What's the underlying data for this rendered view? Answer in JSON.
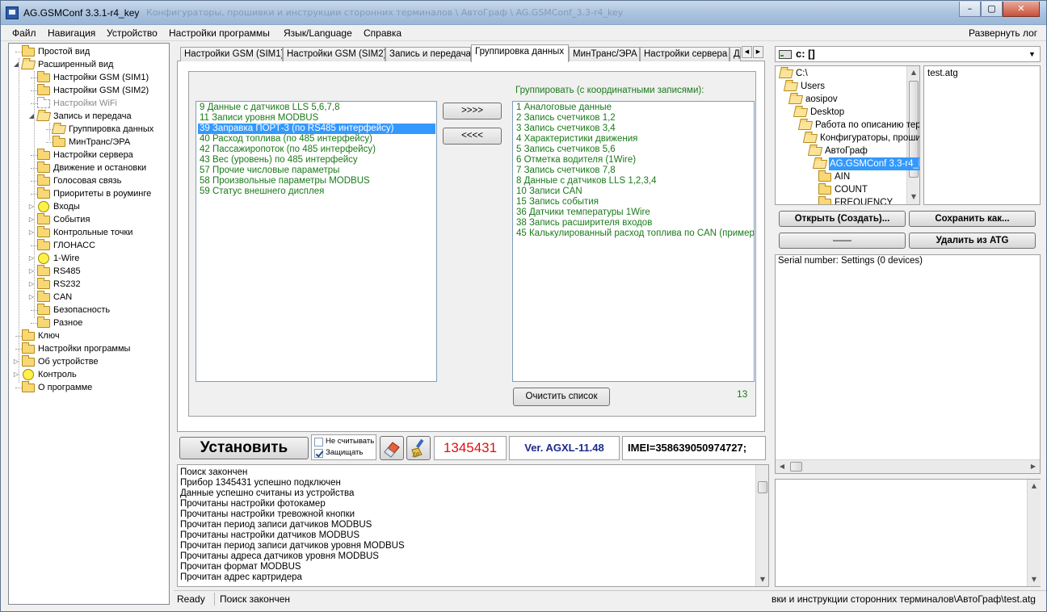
{
  "window": {
    "title": "AG.GSMConf 3.3.1-r4_key",
    "title_extra": "Конфигураторы, прошивки и инструкции сторонних терминалов \\ АвтоГраф \\ AG.GSMConf_3.3-r4_key",
    "minimize": "–",
    "maximize": "▢",
    "close": "✕"
  },
  "menu": {
    "items": [
      "Файл",
      "Навигация",
      "Устройство",
      "Настройки программы",
      "Язык/Language",
      "Справка"
    ],
    "right_item": "Развернуть лог"
  },
  "tree": {
    "nodes": [
      {
        "label": "Простой вид",
        "icon": "folder",
        "level": 0,
        "expander": ""
      },
      {
        "label": "Расширенный вид",
        "icon": "folder-open",
        "level": 0,
        "expander": "◢"
      },
      {
        "label": "Настройки GSM (SIM1)",
        "icon": "folder",
        "level": 1,
        "expander": ""
      },
      {
        "label": "Настройки GSM (SIM2)",
        "icon": "folder",
        "level": 1,
        "expander": ""
      },
      {
        "label": "Настройки WiFi",
        "icon": "folder-ghost",
        "level": 1,
        "expander": "",
        "disabled": true
      },
      {
        "label": "Запись и передача",
        "icon": "folder-open",
        "level": 1,
        "expander": "◢"
      },
      {
        "label": "Группировка данных",
        "icon": "folder-open",
        "level": 2,
        "expander": ""
      },
      {
        "label": "МинТранс/ЭРА",
        "icon": "folder",
        "level": 2,
        "expander": ""
      },
      {
        "label": "Настройки сервера",
        "icon": "folder",
        "level": 1,
        "expander": ""
      },
      {
        "label": "Движение и остановки",
        "icon": "folder",
        "level": 1,
        "expander": ""
      },
      {
        "label": "Голосовая связь",
        "icon": "folder",
        "level": 1,
        "expander": ""
      },
      {
        "label": "Приоритеты в роуминге",
        "icon": "folder",
        "level": 1,
        "expander": ""
      },
      {
        "label": "Входы",
        "icon": "circle",
        "level": 1,
        "expander": "▷"
      },
      {
        "label": "События",
        "icon": "folder",
        "level": 1,
        "expander": "▷"
      },
      {
        "label": "Контрольные точки",
        "icon": "folder",
        "level": 1,
        "expander": "▷"
      },
      {
        "label": "ГЛОНАСС",
        "icon": "folder",
        "level": 1,
        "expander": ""
      },
      {
        "label": "1-Wire",
        "icon": "circle",
        "level": 1,
        "expander": "▷"
      },
      {
        "label": "RS485",
        "icon": "folder",
        "level": 1,
        "expander": "▷"
      },
      {
        "label": "RS232",
        "icon": "folder",
        "level": 1,
        "expander": "▷"
      },
      {
        "label": "CAN",
        "icon": "folder",
        "level": 1,
        "expander": "▷"
      },
      {
        "label": "Безопасность",
        "icon": "folder",
        "level": 1,
        "expander": ""
      },
      {
        "label": "Разное",
        "icon": "folder",
        "level": 1,
        "expander": ""
      },
      {
        "label": "Ключ",
        "icon": "folder",
        "level": 0,
        "expander": ""
      },
      {
        "label": "Настройки программы",
        "icon": "folder",
        "level": 0,
        "expander": ""
      },
      {
        "label": "Об устройстве",
        "icon": "folder",
        "level": 0,
        "expander": "▷"
      },
      {
        "label": "Контроль",
        "icon": "circle",
        "level": 0,
        "expander": "▷"
      },
      {
        "label": "О программе",
        "icon": "folder",
        "level": 0,
        "expander": ""
      }
    ]
  },
  "tabs": {
    "items": [
      "Настройки GSM (SIM1)",
      "Настройки GSM (SIM2)",
      "Запись и передача",
      "Группировка данных",
      "МинТранс/ЭРА",
      "Настройки сервера",
      "Д"
    ],
    "active_index": 3,
    "scroll_left": "◀",
    "scroll_right": "▶"
  },
  "grouping": {
    "available": [
      {
        "text": "9 Данные с датчиков LLS 5,6,7,8"
      },
      {
        "text": "11 Записи уровня MODBUS"
      },
      {
        "text": "39 Заправка ПОРТ-3 (по RS485 интерфейсу)",
        "selected": true
      },
      {
        "text": "40 Расход топлива (по 485 интерфейсу)"
      },
      {
        "text": "42 Пассажиропоток (по 485 интерфейсу)"
      },
      {
        "text": "43 Вес (уровень) по 485 интерфейсу"
      },
      {
        "text": "57 Прочие числовые параметры"
      },
      {
        "text": "58 Произвольные параметры MODBUS"
      },
      {
        "text": "59 Статус внешнего дисплея"
      }
    ],
    "move_right_label": ">>>>",
    "move_left_label": "<<<<",
    "grouped_label": "Группировать (с координатными записями):",
    "grouped": [
      "1 Аналоговые данные",
      "2 Запись счетчиков 1,2",
      "3 Запись счетчиков 3,4",
      "4 Характеристики движения",
      "5 Запись счетчиков 5,6",
      "6 Отметка водителя (1Wire)",
      "7 Запись счетчиков 7,8",
      "8 Данные с датчиков LLS 1,2,3,4",
      "10 Записи CAN",
      "15 Запись события",
      "36 Датчики температуры 1Wire",
      "38 Запись расширителя входов",
      "45 Калькулированный расход топлива по CAN (примерный)"
    ],
    "clear_label": "Очистить список",
    "count": "13"
  },
  "toolbar": {
    "install_label": "Установить",
    "no_read_label": "Не считывать",
    "no_read_checked": false,
    "protect_label": "Защищать",
    "protect_checked": true,
    "serial": "1345431",
    "version": "Ver. AGXL-11.48",
    "imei": "IMEI=358639050974727;"
  },
  "log": {
    "lines": [
      "Поиск закончен",
      "Прибор 1345431 успешно подключен",
      "Данные успешно считаны из устройства",
      "Прочитаны настройки фотокамер",
      "Прочитаны настройки тревожной кнопки",
      "Прочитан период записи датчиков MODBUS",
      "Прочитаны настройки датчиков MODBUS",
      "Прочитан период записи датчиков уровня MODBUS",
      "Прочитаны адреса датчиков уровня MODBUS",
      "Прочитан формат MODBUS",
      "Прочитан адрес картридера"
    ]
  },
  "status": {
    "ready": "Ready",
    "message": "Поиск закончен",
    "path": "вки и  инструкции сторонних терминалов\\АвтоГраф\\test.atg"
  },
  "files": {
    "drive": "c: []",
    "dirs": [
      {
        "label": "C:\\",
        "indent": 0,
        "open": true
      },
      {
        "label": "Users",
        "indent": 1,
        "open": true
      },
      {
        "label": "aosipov",
        "indent": 2,
        "open": true
      },
      {
        "label": "Desktop",
        "indent": 3,
        "open": true
      },
      {
        "label": "Работа по описанию тер",
        "indent": 4,
        "open": true
      },
      {
        "label": "Конфигураторы, проши",
        "indent": 5,
        "open": true
      },
      {
        "label": "АвтоГраф",
        "indent": 6,
        "open": true
      },
      {
        "label": "AG.GSMConf 3.3-r4_ke",
        "indent": 7,
        "open": true,
        "selected": true
      },
      {
        "label": "AIN",
        "indent": 8,
        "open": false
      },
      {
        "label": "COUNT",
        "indent": 8,
        "open": false
      },
      {
        "label": "FREQUENCY",
        "indent": 8,
        "open": false
      }
    ],
    "file_items": [
      "test.atg"
    ],
    "open_label": "Открыть (Создать)...",
    "save_as_label": "Сохранить как...",
    "blank_label": "——",
    "delete_label": "Удалить из ATG"
  },
  "devices": {
    "header": "Serial number: Settings (0 devices)"
  }
}
